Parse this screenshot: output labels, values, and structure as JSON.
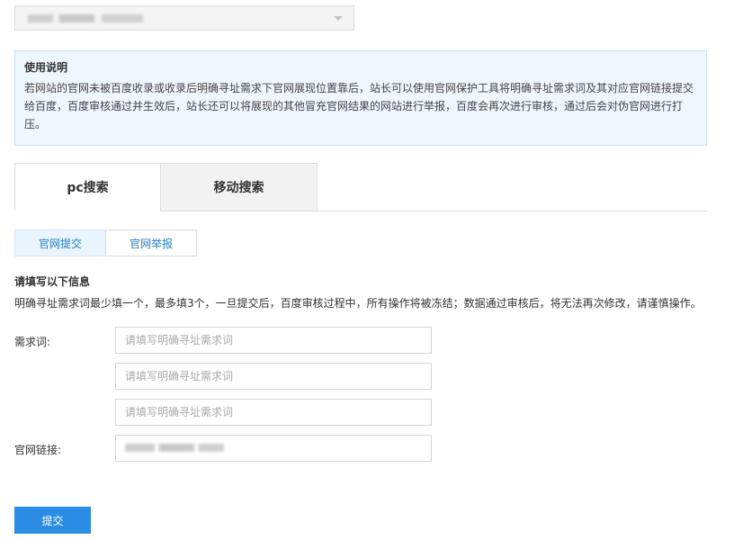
{
  "site_select": {
    "value": "",
    "icon": "chevron-down-icon"
  },
  "notice": {
    "title": "使用说明",
    "text": "若网站的官网未被百度收录或收录后明确寻址需求下官网展现位置靠后，站长可以使用官网保护工具将明确寻址需求词及其对应官网链接提交给百度，百度审核通过并生效后，站长还可以将展现的其他冒充官网结果的网站进行举报，百度会再次进行审核，通过后会对伪官网进行打压。"
  },
  "tabs": [
    {
      "label": "pc搜索",
      "active": true
    },
    {
      "label": "移动搜索",
      "active": false
    }
  ],
  "subtabs": [
    {
      "label": "官网提交",
      "active": true
    },
    {
      "label": "官网举报",
      "active": false
    }
  ],
  "form": {
    "title": "请填写以下信息",
    "hint": "明确寻址需求词最少填一个，最多填3个，一旦提交后，百度审核过程中，所有操作将被冻结；数据通过审核后，将无法再次修改，请谨慎操作。",
    "keyword_label": "需求词:",
    "keyword_placeholder": "请填写明确寻址需求词",
    "keywords": [
      "",
      "",
      ""
    ],
    "url_label": "官网链接:",
    "url_value": "",
    "submit_label": "提交"
  },
  "colors": {
    "accent": "#2b8ce3",
    "link": "#2580c3",
    "notice_bg": "#eef7fe",
    "notice_border": "#c7e2f7"
  }
}
